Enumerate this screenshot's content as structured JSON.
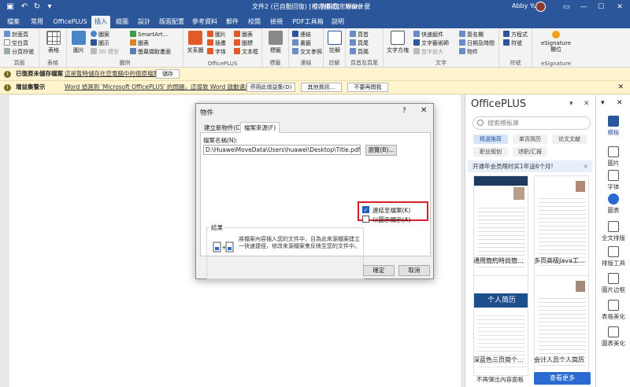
{
  "titlebar": {
    "doc_title": "文件2 (已自動回復) [相容模式] - Word",
    "search": "告訴我您想做什麼",
    "user": "Abby Yu",
    "share": "共用"
  },
  "tabs": [
    "檔案",
    "常用",
    "OfficePLUS",
    "插入",
    "繪圖",
    "設計",
    "版面配置",
    "參考資料",
    "郵件",
    "校閱",
    "檢視",
    "PDF工具箱",
    "說明"
  ],
  "ribbon": {
    "pages_group": {
      "label": "頁面",
      "items": [
        "封面頁",
        "空白頁",
        "分頁符號"
      ]
    },
    "table_group": {
      "label": "表格",
      "item": "表格"
    },
    "illustrations_group": {
      "label": "圖例",
      "picture": "圖片",
      "items": [
        "圖案",
        "圖示",
        "3D 模型",
        "SmartArt...",
        "圖表",
        "螢幕擷取畫面"
      ]
    },
    "officeplus_group": {
      "label": "OfficePLUS",
      "big": "关系圖",
      "items": [
        "圖片",
        "圖表",
        "插畫",
        "圖標",
        "字体",
        "文本框"
      ]
    },
    "comments_group": {
      "label": "標籤",
      "item": "標籤"
    },
    "links_group": {
      "label": "連結",
      "items": [
        "連結",
        "書籤",
        "交叉參照"
      ]
    },
    "comment_group": {
      "label": "註解",
      "item": "註解"
    },
    "headerfooter_group": {
      "label": "頁首及頁尾",
      "items": [
        "頁首",
        "頁尾",
        "頁碼"
      ]
    },
    "text_group": {
      "label": "文字",
      "big": "文字方塊",
      "items": [
        "快速組件",
        "文字藝術師",
        "首字放大",
        "簽名欄",
        "日期及時間",
        "物件"
      ]
    },
    "symbols_group": {
      "label": "符號",
      "items": [
        "方程式",
        "符號"
      ]
    },
    "esig_group": {
      "label": "eSignature",
      "item": "eSignature\n欄位"
    }
  },
  "msgbar1": {
    "title": "已復原未儲存檔案",
    "message": "這是暫時儲存在您電腦中的復原檔案。",
    "button": "儲存"
  },
  "msgbar2": {
    "title": "增益集警示",
    "message": "Word 偵測到 'Microsoft OfficePLUS' 的問題，這導致 Word 啟動速度變慢。",
    "buttons": [
      "停用此增益集(D)",
      "其他資訊...",
      "不要再問我"
    ]
  },
  "pane": {
    "title": "OfficePLUS",
    "search_placeholder": "搜索模板庫",
    "chips": [
      "精選推荐",
      "单页简历",
      "论文文献",
      "职业规划",
      "述职/汇报"
    ],
    "promo": "开通年会员限时买1年送6个月!",
    "templates": [
      "通用簡約時尚簡...",
      "多页高级Java工...",
      "深蓝色三页简个...",
      "会计人员个人简历"
    ],
    "template3_banner": "个人简历",
    "footer_text": "不再彈出內容面板",
    "more_button": "查看更多"
  },
  "iconbar": [
    "模板",
    "圖片",
    "字体",
    "圖表",
    "全文排版",
    "排版工具",
    "圖片边框",
    "表格美化",
    "圖表美化"
  ],
  "dialog": {
    "title": "物件",
    "help": "?",
    "tabs": [
      "建立新物件(C)",
      "檔案來源(F)"
    ],
    "filename_label": "檔案名稱(N):",
    "filename_value": "D:\\HuaweiMoveData\\Users\\huawei\\Desktop\\Title.pdf",
    "browse_button": "瀏覽(B)...",
    "link_checkbox": "連結至檔案(K)",
    "icon_checkbox": "以圖示顯示(A)",
    "result_title": "結果",
    "result_text": "將檔案內容插入您的文件中，且為此來源檔案建立一快速捷徑，修改來源檔案會反映至您的文件中。",
    "ok_button": "確定",
    "cancel_button": "取消"
  },
  "colors": {
    "accent": "#2b579a",
    "highlight": "#d61f26",
    "msgbar": "#fff4ce"
  }
}
